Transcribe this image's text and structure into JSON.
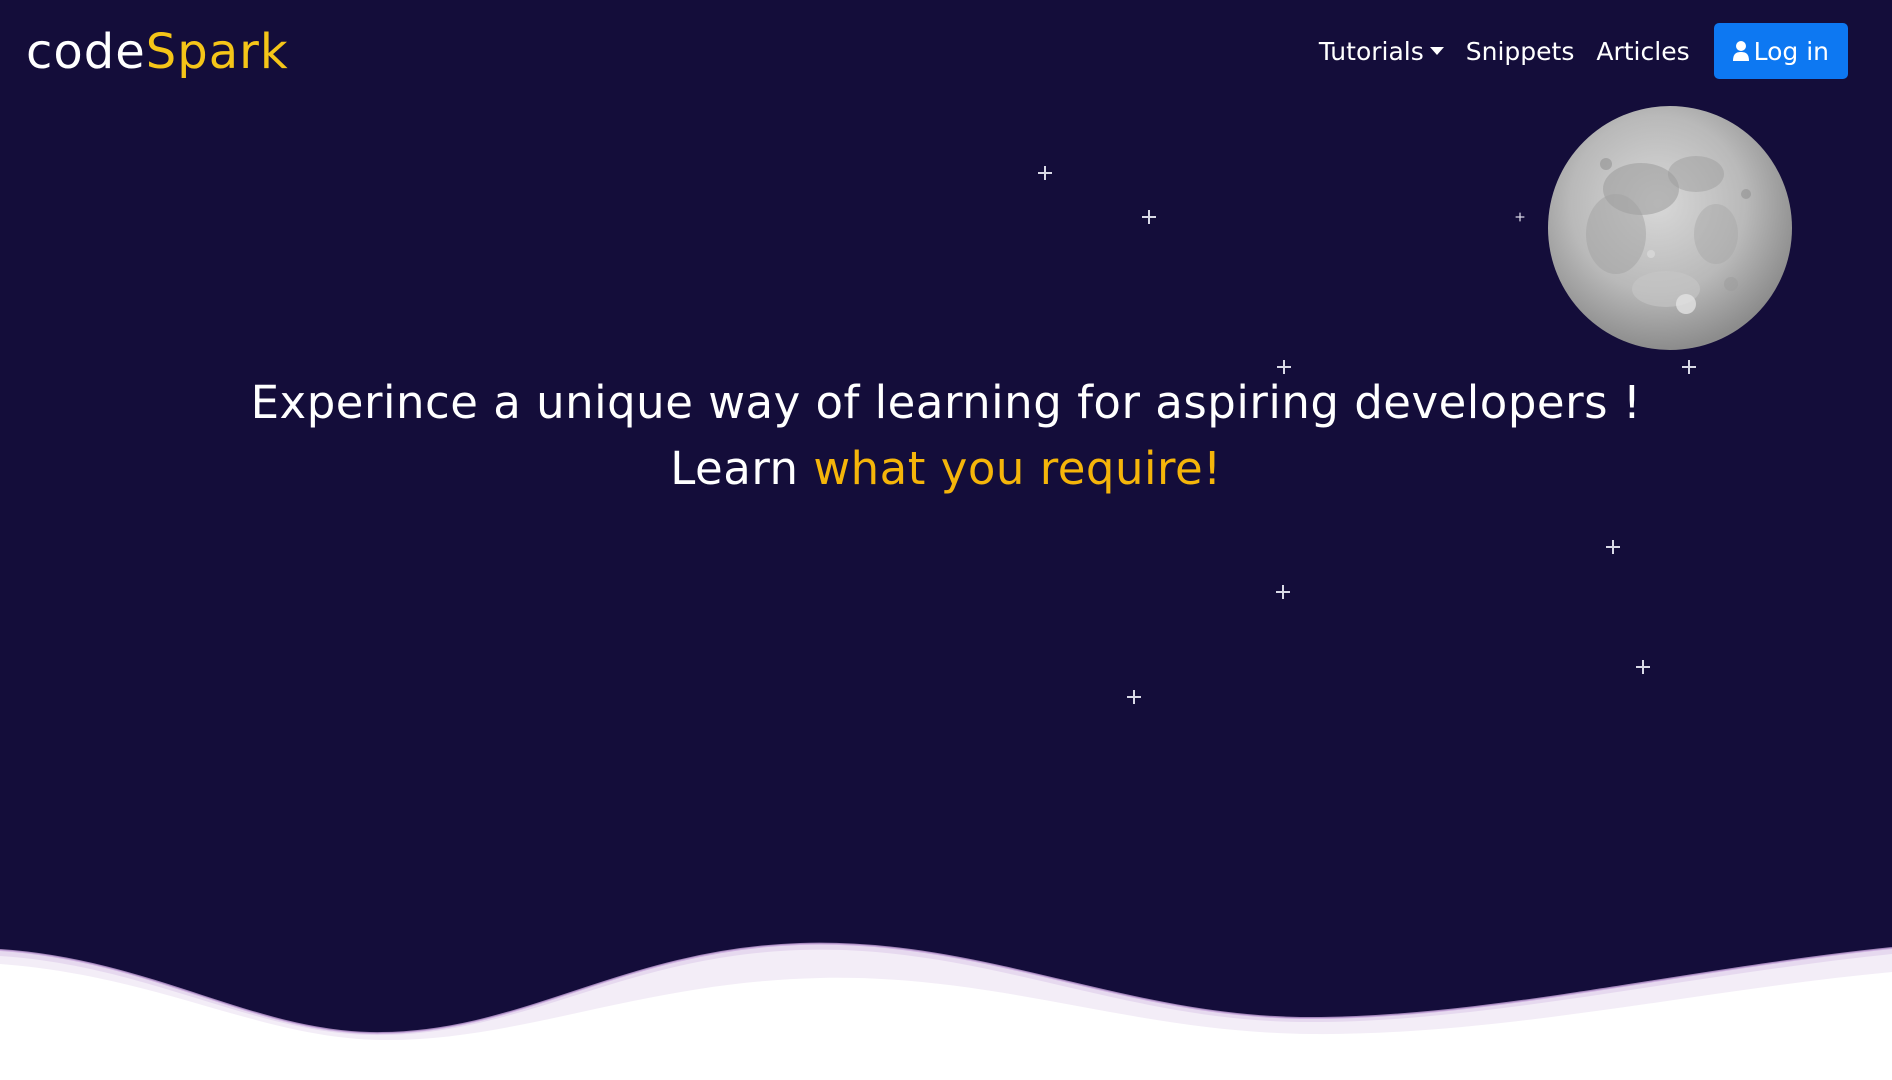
{
  "brand": {
    "name_prefix": "code",
    "name_accent": "Spark",
    "accent_color": "#f5c518"
  },
  "nav": {
    "items": [
      {
        "label": "Tutorials",
        "has_dropdown": true
      },
      {
        "label": "Snippets"
      },
      {
        "label": "Articles"
      }
    ],
    "login_label": "Log in",
    "login_icon": "user-icon",
    "login_color": "#0d78f2"
  },
  "hero": {
    "line1": "Experince a unique way of learning for aspiring developers !",
    "line2_prefix": "Learn ",
    "line2_highlight": "what you require!",
    "highlight_color": "#f5b50a"
  },
  "theme": {
    "background": "#140d3a",
    "wave_color": "#ffffff"
  }
}
